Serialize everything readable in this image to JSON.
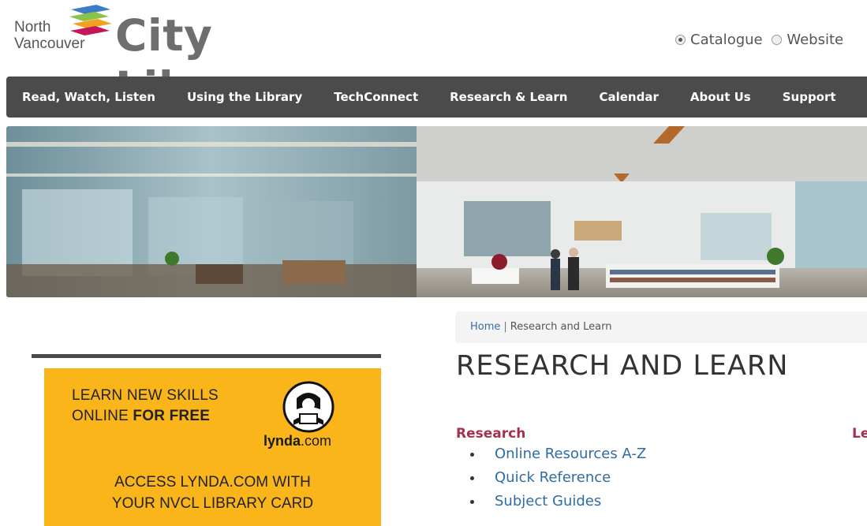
{
  "logo": {
    "line1": "North",
    "line2": "Vancouver",
    "main": "City Library"
  },
  "search_scope": {
    "options": [
      {
        "label": "Catalogue",
        "selected": true
      },
      {
        "label": "Website",
        "selected": false
      }
    ]
  },
  "nav": {
    "items": [
      "Read, Watch, Listen",
      "Using the Library",
      "TechConnect",
      "Research & Learn",
      "Calendar",
      "About Us",
      "Support"
    ]
  },
  "breadcrumb": {
    "home": "Home",
    "separator": "|",
    "current": "Research and Learn"
  },
  "page": {
    "title": "RESEARCH AND LEARN"
  },
  "research": {
    "heading": "Research",
    "links": [
      "Online Resources A-Z",
      "Quick Reference",
      "Subject Guides"
    ]
  },
  "learn": {
    "heading": "Le"
  },
  "ad": {
    "line1": "LEARN NEW SKILLS",
    "line2_prefix": "ONLINE ",
    "line2_bold": "FOR FREE",
    "logo_bold": "lynda",
    "logo_rest": ".com",
    "cta1": "ACCESS LYNDA.COM WITH",
    "cta2": "YOUR NVCL LIBRARY CARD"
  },
  "colors": {
    "nav_bg": "#4b4b4b",
    "accent": "#a7304f",
    "link": "#2e6ca4",
    "ad_bg": "#f9b51a"
  }
}
